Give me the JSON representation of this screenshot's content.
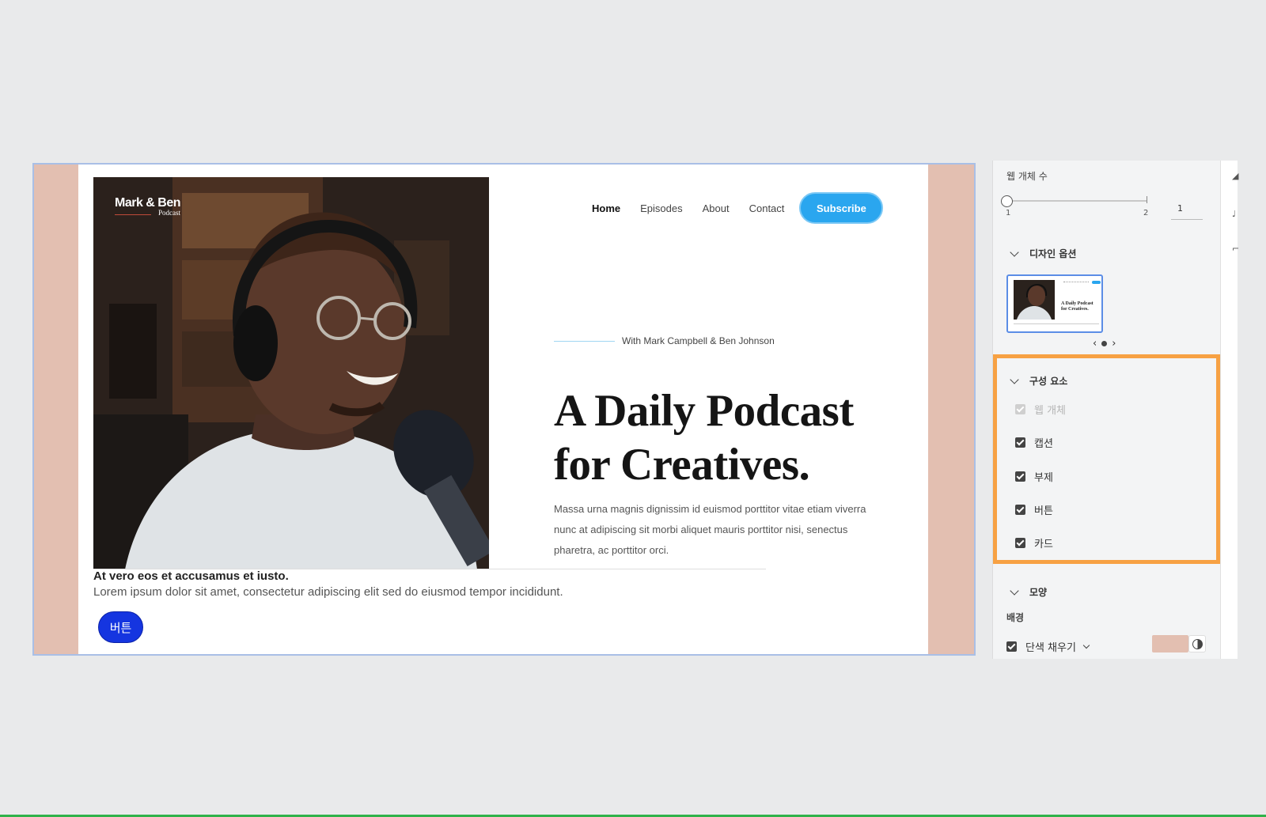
{
  "artboard": {
    "brand": {
      "name": "Mark & Ben",
      "sub": "Podcast"
    },
    "nav": {
      "home": "Home",
      "episodes": "Episodes",
      "about": "About",
      "contact": "Contact",
      "subscribe": "Subscribe"
    },
    "hosts": "With Mark Campbell & Ben Johnson",
    "headline_line1": "A Daily Podcast",
    "headline_line2": "for Creatives.",
    "body": "Massa urna magnis dignissim id euismod porttitor vitae etiam viverra nunc at adipiscing sit morbi aliquet mauris porttitor nisi, senectus pharetra, ac porttitor orci.",
    "caption_title": "At vero eos et accusamus et iusto.",
    "caption_sub": "Lorem ipsum dolor sit amet, consectetur adipiscing elit sed do eiusmod tempor incididunt.",
    "button_label": "버튼"
  },
  "panel": {
    "web_object_count_label": "웹 개체 수",
    "slider": {
      "min_label": "1",
      "max_label": "2",
      "value": "1"
    },
    "design_options_label": "디자인 옵션",
    "thumbnail_headline": "A Daily Podcast for Creatives.",
    "components_label": "구성 요소",
    "components": [
      {
        "label": "웹 개체",
        "checked": true,
        "disabled": true
      },
      {
        "label": "캡션",
        "checked": true,
        "disabled": false
      },
      {
        "label": "부제",
        "checked": true,
        "disabled": false
      },
      {
        "label": "버튼",
        "checked": true,
        "disabled": false
      },
      {
        "label": "카드",
        "checked": true,
        "disabled": false
      }
    ],
    "shape_label": "모양",
    "background_label": "배경",
    "fill_label": "단색 채우기",
    "fill_color": "#e3bfb1"
  },
  "colors": {
    "accent_blue": "#2aa6ef",
    "button_blue": "#1535e0",
    "highlight_orange": "#f7a143"
  }
}
